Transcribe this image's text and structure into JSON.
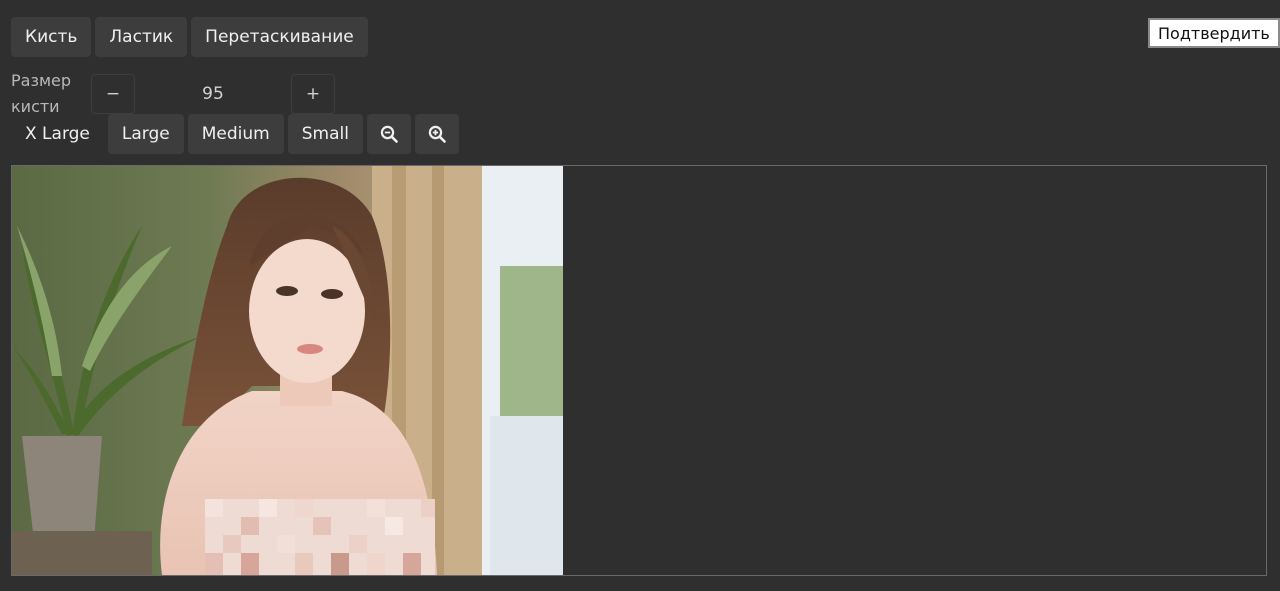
{
  "toolbar": {
    "modes": [
      {
        "label": "Кисть"
      },
      {
        "label": "Ластик"
      },
      {
        "label": "Перетаскивание"
      }
    ],
    "confirm_label": "Подтвердить"
  },
  "brush_size": {
    "label_line1": "Размер",
    "label_line2": "кисти",
    "minus_label": "−",
    "plus_label": "+",
    "value": "95"
  },
  "presets": [
    {
      "label": "X Large"
    },
    {
      "label": "Large"
    },
    {
      "label": "Medium"
    },
    {
      "label": "Small"
    }
  ],
  "zoom": {
    "zoom_out_icon": "zoom-out-icon",
    "zoom_in_icon": "zoom-in-icon"
  },
  "colors": {
    "background": "#2f2f2f",
    "button": "#3d3d3d",
    "canvas_border": "#6a6a6a"
  }
}
